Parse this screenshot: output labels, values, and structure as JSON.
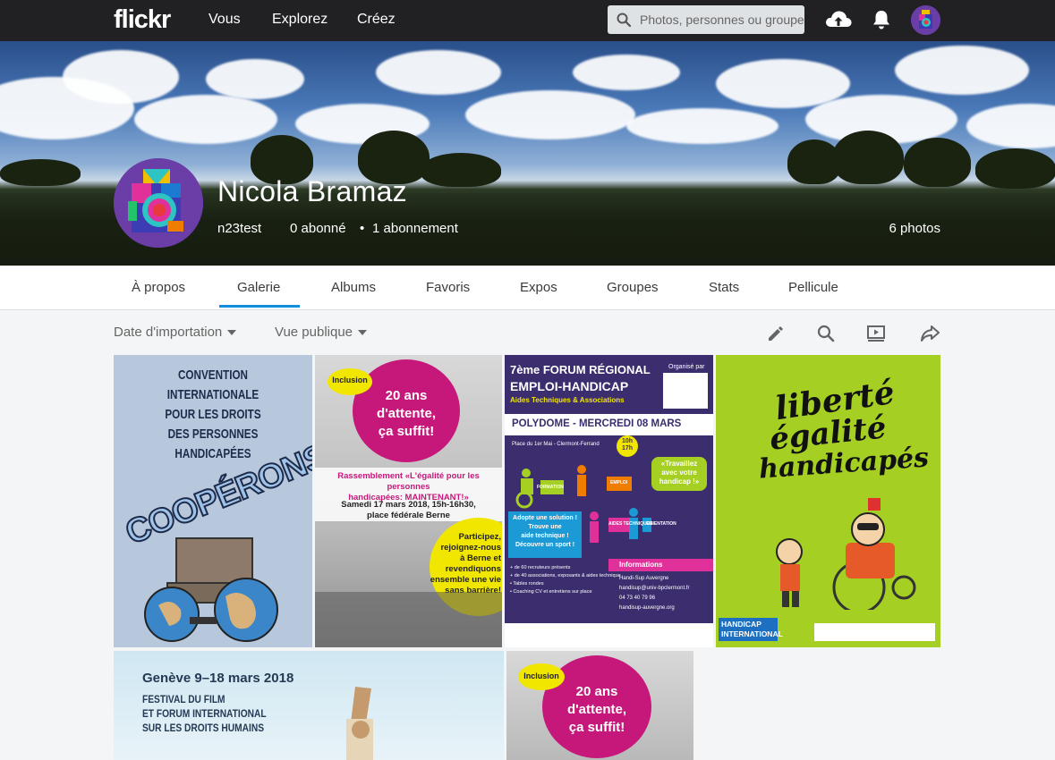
{
  "nav": {
    "logo": "flickr",
    "links": [
      "Vous",
      "Explorez",
      "Créez"
    ],
    "search_placeholder": "Photos, personnes ou groupes"
  },
  "profile": {
    "name": "Nicola Bramaz",
    "username": "n23test",
    "followers": "0 abonné",
    "following": "1 abonnement",
    "photo_count": "6 photos"
  },
  "tabs": [
    "À propos",
    "Galerie",
    "Albums",
    "Favoris",
    "Expos",
    "Groupes",
    "Stats",
    "Pellicule"
  ],
  "active_tab": "Galerie",
  "toolbar": {
    "sort": "Date d'importation",
    "view": "Vue publique"
  },
  "photos": [
    {
      "title_lines": [
        "CONVENTION INTERNATIONALE",
        "POUR LES DROITS",
        "DES PERSONNES HANDICAPÉES"
      ],
      "big_text": "COOPÉRONS..."
    },
    {
      "badge": "Inclusion",
      "circle_text": [
        "20 ans",
        "d'attente,",
        "ça suffit!"
      ],
      "headline": [
        "Rassemblement «L'égalité pour les personnes",
        "handicapées: MAINTENANT!»"
      ],
      "date": [
        "Samedi 17 mars 2018, 15h-16h30,",
        "place fédérale Berne"
      ],
      "call": [
        "Participez,",
        "rejoignez-nous",
        "à Berne et",
        "revendiquons",
        "ensemble une vie",
        "sans barrière!"
      ]
    },
    {
      "title": [
        "7ème FORUM RÉGIONAL",
        "EMPLOI-HANDICAP",
        "Aides Techniques & Associations"
      ],
      "organizer": "Organisé par",
      "event": "POLYDOME - MERCREDI 08 MARS",
      "place": "Place du 1er Mai - Clermont-Ferrand",
      "hours": [
        "10h",
        "17h"
      ],
      "bubble": [
        "«Travaillez",
        "avec votre",
        "handicap !»"
      ],
      "labels": [
        "FORMATION",
        "EMPLOI",
        "AIDES TECHNIQUES",
        "ORIENTATION"
      ],
      "blue_box": [
        "Adopte une solution !",
        "Trouve une",
        "aide technique !",
        "Découvre un sport !"
      ],
      "info_title": "Informations",
      "info": [
        "Handi-Sup Auvergne",
        "handisup@univ-bpclermont.fr",
        "04 73 40 79 96",
        "handisup-auvergne.org"
      ],
      "bullets": [
        "+ de 60 recruteurs présents",
        "+ de 40 associations, exposants & aides technique",
        "• Tables rondes",
        "• Coaching CV et entretiens sur place"
      ]
    },
    {
      "lines": [
        "liberté",
        "égalité",
        "handicapés"
      ],
      "badge": [
        "HANDICAP",
        "INTERNATIONAL"
      ]
    },
    {
      "date": "Genève 9–18 mars 2018",
      "lines": [
        "FESTIVAL DU FILM",
        "ET FORUM INTERNATIONAL",
        "SUR LES DROITS HUMAINS"
      ]
    },
    {
      "badge": "Inclusion",
      "circle_text": [
        "20 ans",
        "d'attente,",
        "ça suffit!"
      ]
    }
  ],
  "colors": {
    "topbar": "#212124",
    "accent": "#128fdc",
    "magenta": "#c6187b",
    "lime": "#a5cf23",
    "navy": "#3b2d6e"
  }
}
